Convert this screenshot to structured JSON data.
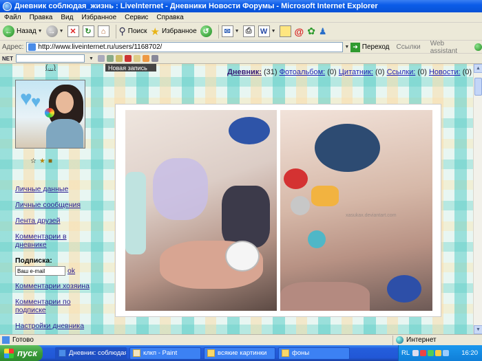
{
  "window": {
    "title": "Дневник соблюдая_жизнь : LiveInternet - Дневники Новости Форумы - Microsoft Internet Explorer"
  },
  "menu": [
    "Файл",
    "Правка",
    "Вид",
    "Избранное",
    "Сервис",
    "Справка"
  ],
  "toolbar": {
    "back_label": "Назад",
    "search_label": "Поиск",
    "favorites_label": "Избранное"
  },
  "address": {
    "label": "Адрес:",
    "url": "http://www.liveinternet.ru/users/1168702/",
    "go_label": "Переход",
    "links_label": "Ссылки",
    "assistant_label": "Web assistant"
  },
  "linksbar": {
    "net_logo": "NET"
  },
  "page": {
    "top_link": "(...)",
    "new_post_tab": "Новая запись",
    "nav": {
      "diary": "Дневник:",
      "diary_count": "(31)",
      "photo": "Фотоальбом:",
      "photo_count": "(0)",
      "quotes": "Цитатник:",
      "quotes_count": "(0)",
      "links": "Ссылки:",
      "links_count": "(0)",
      "news": "Новости:",
      "news_count": "(0)"
    },
    "sidebar": {
      "personal_data": "Личные данные",
      "personal_messages": "Личные сообщения",
      "friends_feed": "Лента друзей",
      "diary_comments": "Комментарии в дневнике",
      "subscribe_label": "Подписка:",
      "email_placeholder": "Ваш e-mail",
      "ok": "ok",
      "owner_comments": "Комментарии хозяина",
      "subscription_comments": "Комментарии по подписке",
      "diary_settings": "Настройки дневника"
    },
    "photo_watermark": "xasukax.deviantart.com"
  },
  "status": {
    "text": "Готово",
    "zone": "Интернет"
  },
  "taskbar": {
    "start": "пуск",
    "tasks": [
      "Дневник: соблюдая_...",
      "клкп - Paint",
      "всякие картинки",
      "фоны"
    ],
    "lang": "RL",
    "clock": "16:20"
  }
}
